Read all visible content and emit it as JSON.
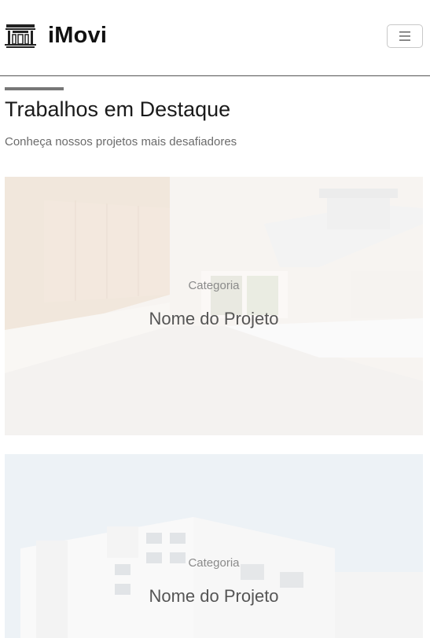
{
  "navbar": {
    "brand_name": "iMovi",
    "brand_icon": "building-icon",
    "menu_icon": "hamburger-menu-icon"
  },
  "featured": {
    "title": "Trabalhos em Destaque",
    "subtitle": "Conheça nossos projetos mais desafiadores",
    "projects": [
      {
        "category": "Categoria",
        "name": "Nome do Projeto",
        "image": "kitchen-interior-photo"
      },
      {
        "category": "Categoria",
        "name": "Nome do Projeto",
        "image": "modern-building-photo"
      }
    ]
  },
  "colors": {
    "accent_bar": "#777777",
    "border": "#555555",
    "text_dark": "#1a1a1a",
    "text_muted": "#6b6b6b"
  }
}
